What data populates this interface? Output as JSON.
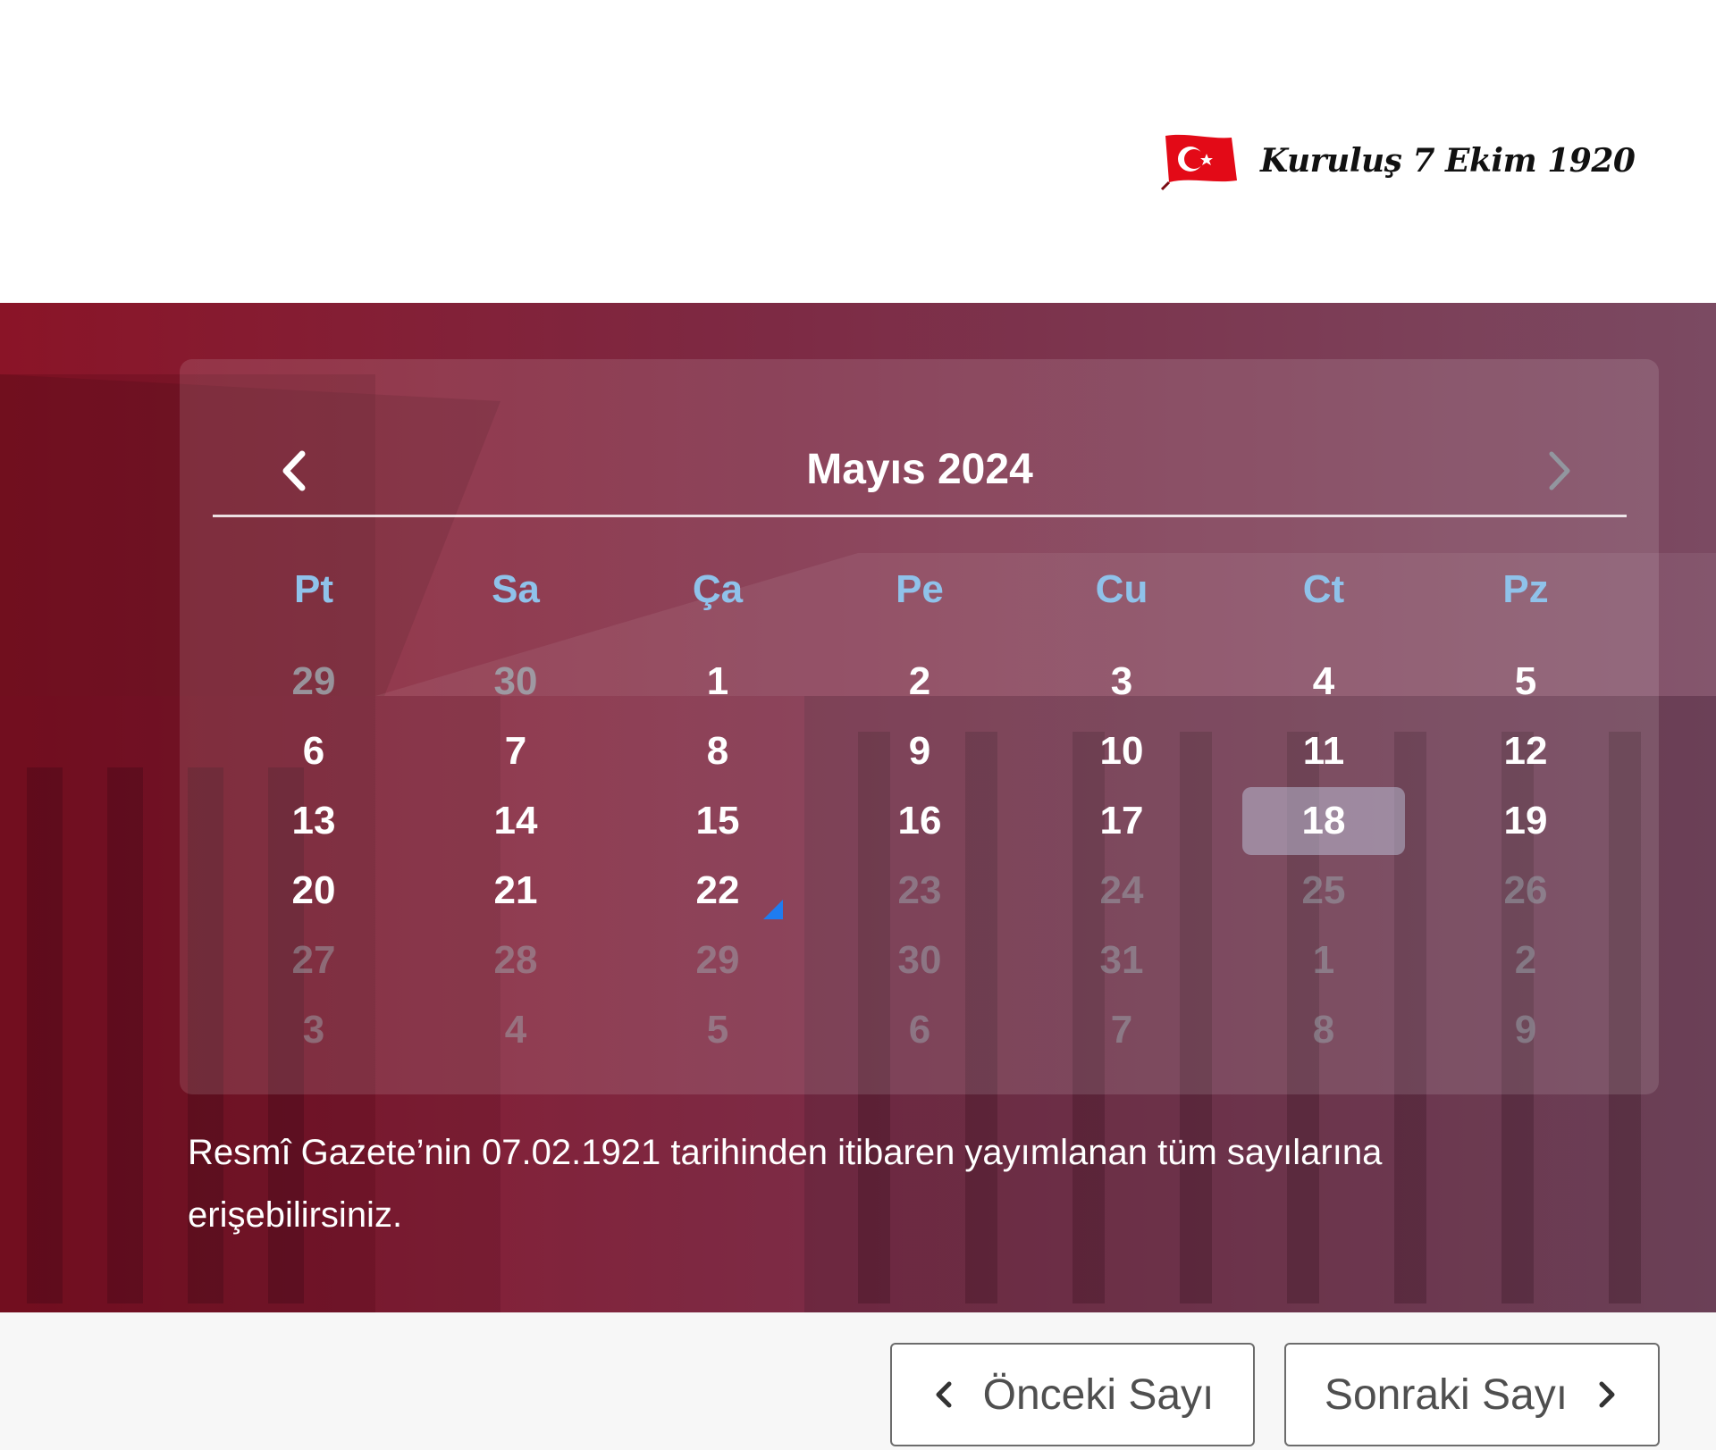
{
  "header": {
    "founding_text": "Kuruluş 7 Ekim 1920",
    "flag_icon": "turkish-flag-icon",
    "flag_color": "#e30a17"
  },
  "calendar": {
    "month_title": "Mayıs 2024",
    "prev_icon": "chevron-left-icon",
    "next_icon": "chevron-right-icon",
    "weekdays": [
      "Pt",
      "Sa",
      "Ça",
      "Pe",
      "Cu",
      "Ct",
      "Pz"
    ],
    "weeks": [
      [
        {
          "d": "29",
          "s": "muted"
        },
        {
          "d": "30",
          "s": "muted"
        },
        {
          "d": "1"
        },
        {
          "d": "2"
        },
        {
          "d": "3"
        },
        {
          "d": "4"
        },
        {
          "d": "5"
        }
      ],
      [
        {
          "d": "6"
        },
        {
          "d": "7"
        },
        {
          "d": "8"
        },
        {
          "d": "9"
        },
        {
          "d": "10"
        },
        {
          "d": "11"
        },
        {
          "d": "12"
        }
      ],
      [
        {
          "d": "13"
        },
        {
          "d": "14"
        },
        {
          "d": "15"
        },
        {
          "d": "16"
        },
        {
          "d": "17"
        },
        {
          "d": "18",
          "s": "selected"
        },
        {
          "d": "19"
        }
      ],
      [
        {
          "d": "20"
        },
        {
          "d": "21"
        },
        {
          "d": "22",
          "s": "today"
        },
        {
          "d": "23",
          "s": "faint"
        },
        {
          "d": "24",
          "s": "faint"
        },
        {
          "d": "25",
          "s": "faint"
        },
        {
          "d": "26",
          "s": "faint"
        }
      ],
      [
        {
          "d": "27",
          "s": "faint"
        },
        {
          "d": "28",
          "s": "faint"
        },
        {
          "d": "29",
          "s": "faint"
        },
        {
          "d": "30",
          "s": "faint"
        },
        {
          "d": "31",
          "s": "faint"
        },
        {
          "d": "1",
          "s": "faint"
        },
        {
          "d": "2",
          "s": "faint"
        }
      ],
      [
        {
          "d": "3",
          "s": "faint"
        },
        {
          "d": "4",
          "s": "faint"
        },
        {
          "d": "5",
          "s": "faint"
        },
        {
          "d": "6",
          "s": "faint"
        },
        {
          "d": "7",
          "s": "faint"
        },
        {
          "d": "8",
          "s": "faint"
        },
        {
          "d": "9",
          "s": "faint"
        }
      ]
    ],
    "selected_day": "18",
    "today_marker_color": "#1e7cf0",
    "weekday_color": "#8fc2ea"
  },
  "info": {
    "text": "Resmî Gazete’nin 07.02.1921 tarihinden itibaren yayımlanan tüm sayılarına erişebilirsiniz."
  },
  "pager": {
    "prev_label": "Önceki Sayı",
    "next_label": "Sonraki Sayı",
    "prev_icon": "chevron-left-icon",
    "next_icon": "chevron-right-icon"
  },
  "colors": {
    "hero_start": "#8a1427",
    "hero_end": "#7b4a62",
    "footer_bg": "#f7f7f7"
  }
}
